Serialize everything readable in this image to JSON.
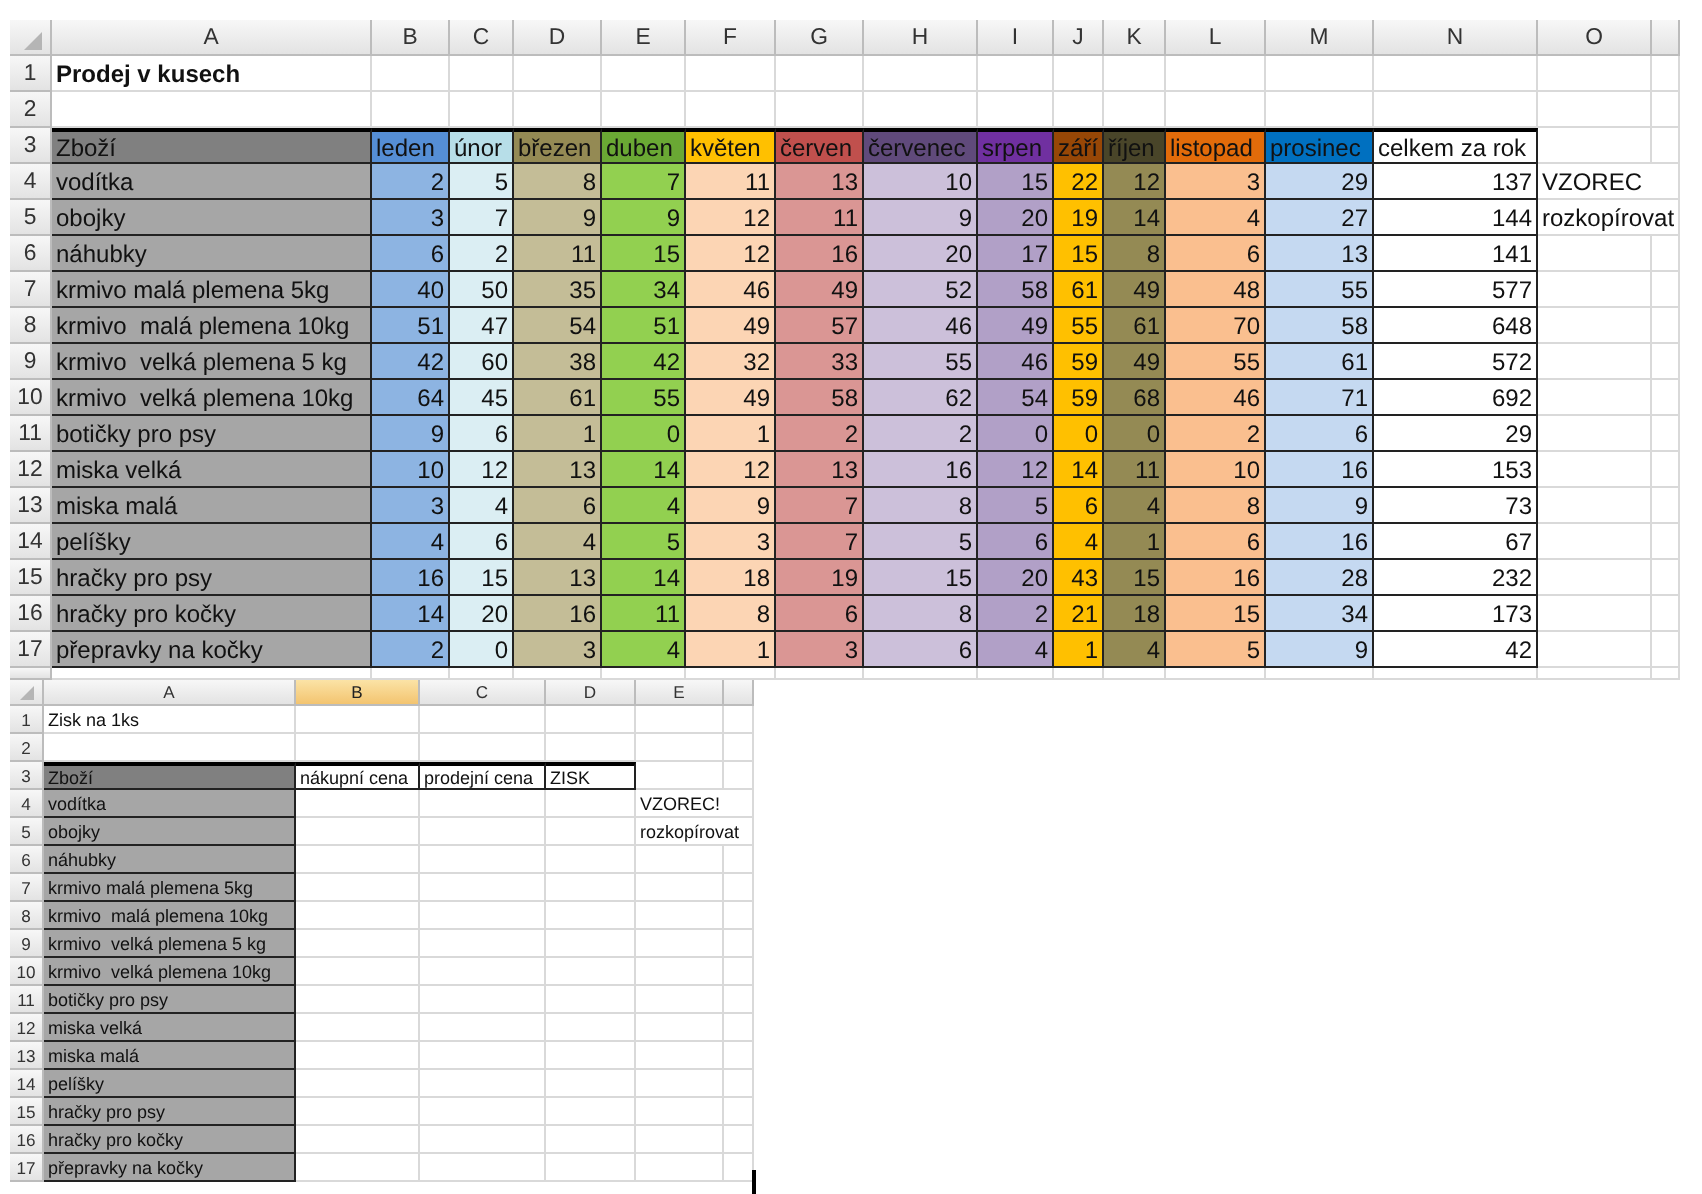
{
  "sheets": [
    {
      "column_letters": [
        {
          "label": "A",
          "selected": false
        },
        {
          "label": "B",
          "selected": false
        },
        {
          "label": "C",
          "selected": false
        },
        {
          "label": "D",
          "selected": false
        },
        {
          "label": "E",
          "selected": false
        },
        {
          "label": "F",
          "selected": false
        },
        {
          "label": "G",
          "selected": false
        },
        {
          "label": "H",
          "selected": false
        },
        {
          "label": "I",
          "selected": false
        },
        {
          "label": "J",
          "selected": false
        },
        {
          "label": "K",
          "selected": false
        },
        {
          "label": "L",
          "selected": false
        },
        {
          "label": "M",
          "selected": false
        },
        {
          "label": "N",
          "selected": false
        },
        {
          "label": "O",
          "selected": false
        }
      ],
      "row_numbers": [
        "1",
        "2",
        "3",
        "4",
        "5",
        "6",
        "7",
        "8",
        "9",
        "10",
        "11",
        "12",
        "13",
        "14",
        "15",
        "16",
        "17"
      ],
      "title": "Prodej v kusech",
      "table": {
        "header_item": "Zboží",
        "columns": [
          {
            "label": "leden",
            "color": "#558ed5",
            "fill": {
              "color": "#8db4e2"
            }
          },
          {
            "label": "únor",
            "color": "#b7dee8",
            "fill": {
              "color": "#dbeef3"
            }
          },
          {
            "label": "březen",
            "color": "#948a54",
            "fill": {
              "color": "#c4bd97"
            }
          },
          {
            "label": "duben",
            "color": "#6aa834",
            "fill": {
              "color": "#92d050"
            }
          },
          {
            "label": "květen",
            "color": "#ffc000",
            "fill": {
              "color": "#fcd5b4"
            }
          },
          {
            "label": "červen",
            "color": "#c0504d",
            "fill": {
              "color": "#da9694"
            }
          },
          {
            "label": "červenec",
            "color": "#604a7b",
            "fill": {
              "color": "#ccc0da"
            }
          },
          {
            "label": "srpen",
            "color": "#7030a0",
            "fill": {
              "color": "#b1a0c7"
            }
          },
          {
            "label": "září",
            "color": "#974706",
            "fill": {
              "color": "#ffc000"
            }
          },
          {
            "label": "říjen",
            "color": "#494529",
            "fill": {
              "color": "#948a54"
            }
          },
          {
            "label": "listopad",
            "color": "#e26b0a",
            "fill": {
              "color": "#fabf8f"
            }
          },
          {
            "label": "prosinec",
            "color": "#0070c0",
            "fill": {
              "color": "#c5d9f1"
            }
          },
          {
            "label": "celkem za rok"
          }
        ],
        "rows": [
          {
            "item": "vodítka",
            "values": [
              "2",
              "5",
              "8",
              "7",
              "11",
              "13",
              "10",
              "15",
              "22",
              "12",
              "3",
              "29",
              "137"
            ]
          },
          {
            "item": "obojky",
            "values": [
              "3",
              "7",
              "9",
              "9",
              "12",
              "11",
              "9",
              "20",
              "19",
              "14",
              "4",
              "27",
              "144"
            ]
          },
          {
            "item": "náhubky",
            "values": [
              "6",
              "2",
              "11",
              "15",
              "12",
              "16",
              "20",
              "17",
              "15",
              "8",
              "6",
              "13",
              "141"
            ]
          },
          {
            "item": "krmivo malá plemena 5kg",
            "values": [
              "40",
              "50",
              "35",
              "34",
              "46",
              "49",
              "52",
              "58",
              "61",
              "49",
              "48",
              "55",
              "577"
            ]
          },
          {
            "item": "krmivo  malá plemena 10kg",
            "values": [
              "51",
              "47",
              "54",
              "51",
              "49",
              "57",
              "46",
              "49",
              "55",
              "61",
              "70",
              "58",
              "648"
            ]
          },
          {
            "item": "krmivo  velká plemena 5 kg",
            "values": [
              "42",
              "60",
              "38",
              "42",
              "32",
              "33",
              "55",
              "46",
              "59",
              "49",
              "55",
              "61",
              "572"
            ]
          },
          {
            "item": "krmivo  velká plemena 10kg",
            "values": [
              "64",
              "45",
              "61",
              "55",
              "49",
              "58",
              "62",
              "54",
              "59",
              "68",
              "46",
              "71",
              "692"
            ]
          },
          {
            "item": "botičky pro psy",
            "values": [
              "9",
              "6",
              "1",
              "0",
              "1",
              "2",
              "2",
              "0",
              "0",
              "0",
              "2",
              "6",
              "29"
            ]
          },
          {
            "item": "miska velká",
            "values": [
              "10",
              "12",
              "13",
              "14",
              "12",
              "13",
              "16",
              "12",
              "14",
              "11",
              "10",
              "16",
              "153"
            ]
          },
          {
            "item": "miska malá",
            "values": [
              "3",
              "4",
              "6",
              "4",
              "9",
              "7",
              "8",
              "5",
              "6",
              "4",
              "8",
              "9",
              "73"
            ]
          },
          {
            "item": "pelíšky",
            "values": [
              "4",
              "6",
              "4",
              "5",
              "3",
              "7",
              "5",
              "6",
              "4",
              "1",
              "6",
              "16",
              "67"
            ]
          },
          {
            "item": "hračky pro psy",
            "values": [
              "16",
              "15",
              "13",
              "14",
              "18",
              "19",
              "15",
              "20",
              "43",
              "15",
              "16",
              "28",
              "232"
            ]
          },
          {
            "item": "hračky pro kočky",
            "values": [
              "14",
              "20",
              "16",
              "11",
              "8",
              "6",
              "8",
              "2",
              "21",
              "18",
              "15",
              "34",
              "173"
            ]
          },
          {
            "item": "přepravky na kočky",
            "values": [
              "2",
              "0",
              "3",
              "4",
              "1",
              "3",
              "6",
              "4",
              "1",
              "4",
              "5",
              "9",
              "42"
            ]
          }
        ]
      },
      "notes": [
        "VZOREC",
        "rozkopírovat"
      ]
    },
    {
      "column_letters": [
        {
          "label": "A",
          "selected": false
        },
        {
          "label": "B",
          "selected": true
        },
        {
          "label": "C",
          "selected": false
        },
        {
          "label": "D",
          "selected": false
        },
        {
          "label": "E",
          "selected": false
        }
      ],
      "row_numbers": [
        "1",
        "2",
        "3",
        "4",
        "5",
        "6",
        "7",
        "8",
        "9",
        "10",
        "11",
        "12",
        "13",
        "14",
        "15",
        "16",
        "17"
      ],
      "title": "Zisk na 1ks",
      "table": {
        "header_item": "Zboží",
        "columns": [
          {
            "label": "nákupní cena"
          },
          {
            "label": "prodejní cena"
          },
          {
            "label": "ZISK"
          }
        ],
        "rows": [
          {
            "item": "vodítka"
          },
          {
            "item": "obojky"
          },
          {
            "item": "náhubky"
          },
          {
            "item": "krmivo malá plemena 5kg"
          },
          {
            "item": "krmivo  malá plemena 10kg"
          },
          {
            "item": "krmivo  velká plemena 5 kg"
          },
          {
            "item": "krmivo  velká plemena 10kg"
          },
          {
            "item": "botičky pro psy"
          },
          {
            "item": "miska velká"
          },
          {
            "item": "miska malá"
          },
          {
            "item": "pelíšky"
          },
          {
            "item": "hračky pro psy"
          },
          {
            "item": "hračky pro kočky"
          },
          {
            "item": "přepravky na kočky"
          }
        ]
      },
      "notes": [
        "VZOREC!",
        "rozkopírovat"
      ]
    }
  ]
}
